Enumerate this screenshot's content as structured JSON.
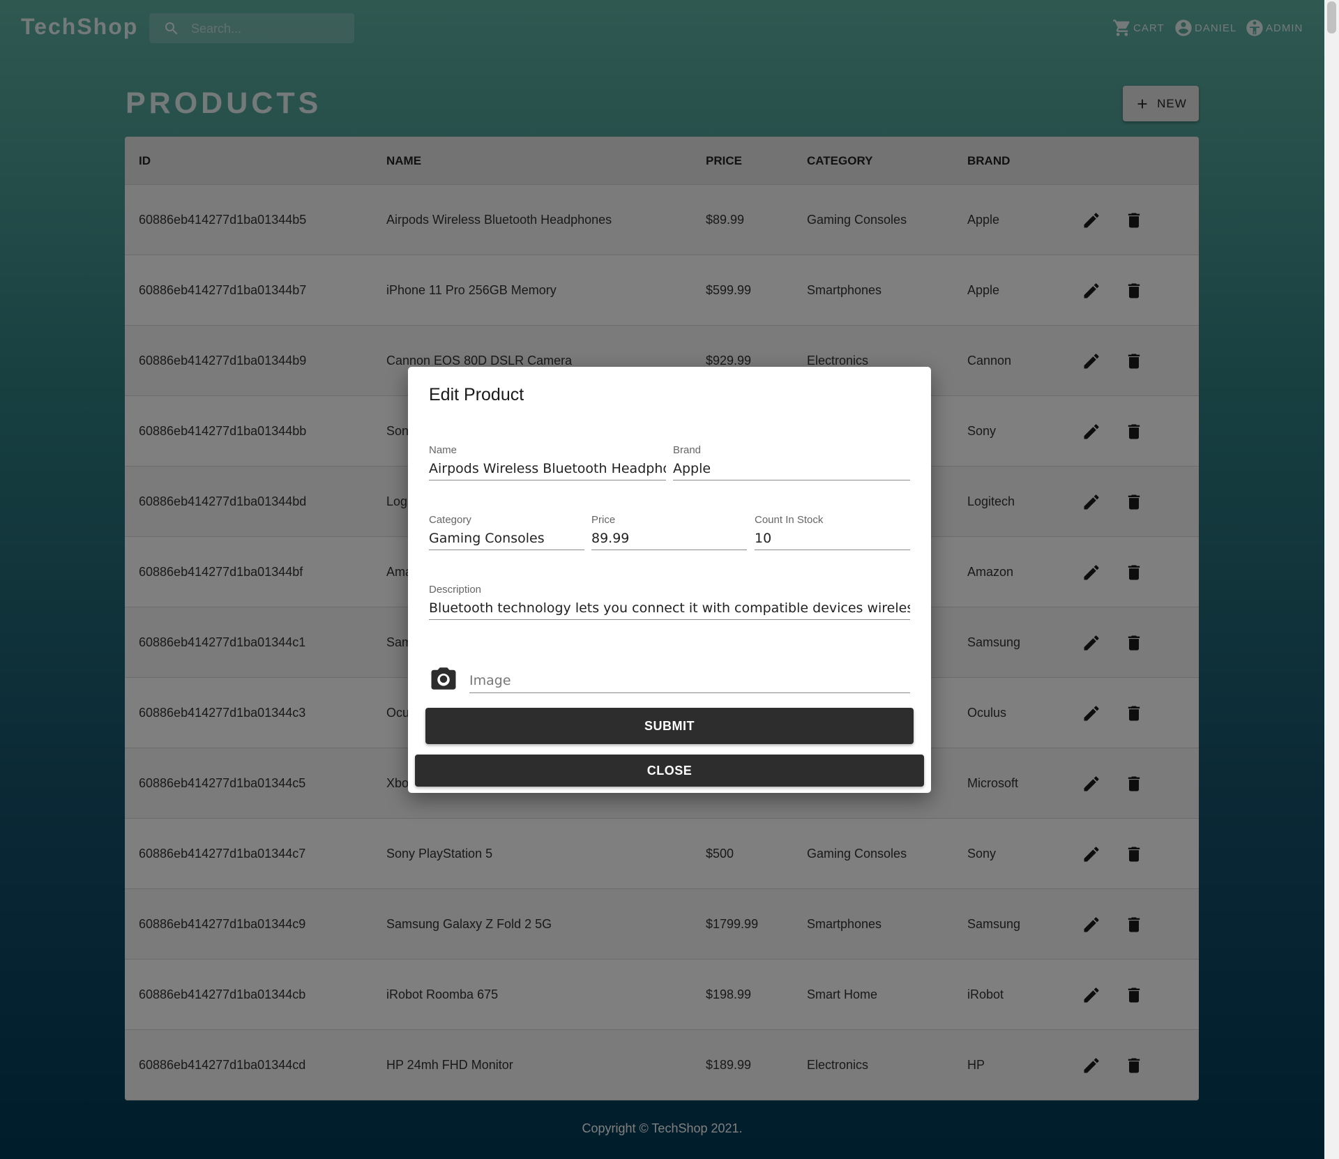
{
  "header": {
    "logo": "TechShop",
    "search_placeholder": "Search...",
    "nav": {
      "cart": "CART",
      "user": "DANIEL",
      "admin": "ADMIN"
    }
  },
  "products": {
    "title": "PRODUCTS",
    "new_label": "NEW",
    "columns": {
      "id": "ID",
      "name": "NAME",
      "price": "PRICE",
      "category": "CATEGORY",
      "brand": "BRAND"
    },
    "rows": [
      {
        "id": "60886eb414277d1ba01344b5",
        "name": "Airpods Wireless Bluetooth Headphones",
        "price": "$89.99",
        "category": "Gaming Consoles",
        "brand": "Apple"
      },
      {
        "id": "60886eb414277d1ba01344b7",
        "name": "iPhone 11 Pro 256GB Memory",
        "price": "$599.99",
        "category": "Smartphones",
        "brand": "Apple"
      },
      {
        "id": "60886eb414277d1ba01344b9",
        "name": "Cannon EOS 80D DSLR Camera",
        "price": "$929.99",
        "category": "Electronics",
        "brand": "Cannon"
      },
      {
        "id": "60886eb414277d1ba01344bb",
        "name": "Son",
        "price": "",
        "category": "",
        "brand": "Sony"
      },
      {
        "id": "60886eb414277d1ba01344bd",
        "name": "Log",
        "price": "",
        "category": "",
        "brand": "Logitech"
      },
      {
        "id": "60886eb414277d1ba01344bf",
        "name": "Ama",
        "price": "",
        "category": "",
        "brand": "Amazon"
      },
      {
        "id": "60886eb414277d1ba01344c1",
        "name": "Sam",
        "price": "",
        "category": "",
        "brand": "Samsung"
      },
      {
        "id": "60886eb414277d1ba01344c3",
        "name": "Ocu",
        "price": "",
        "category": "",
        "brand": "Oculus"
      },
      {
        "id": "60886eb414277d1ba01344c5",
        "name": "Xbo",
        "price": "",
        "category": "",
        "brand": "Microsoft"
      },
      {
        "id": "60886eb414277d1ba01344c7",
        "name": "Sony PlayStation 5",
        "price": "$500",
        "category": "Gaming Consoles",
        "brand": "Sony"
      },
      {
        "id": "60886eb414277d1ba01344c9",
        "name": "Samsung Galaxy Z Fold 2 5G",
        "price": "$1799.99",
        "category": "Smartphones",
        "brand": "Samsung"
      },
      {
        "id": "60886eb414277d1ba01344cb",
        "name": "iRobot Roomba 675",
        "price": "$198.99",
        "category": "Smart Home",
        "brand": "iRobot"
      },
      {
        "id": "60886eb414277d1ba01344cd",
        "name": "HP 24mh FHD Monitor",
        "price": "$189.99",
        "category": "Electronics",
        "brand": "HP"
      }
    ]
  },
  "footer": {
    "text": "Copyright © TechShop 2021."
  },
  "dialog": {
    "title": "Edit Product",
    "fields": {
      "name": {
        "label": "Name",
        "value": "Airpods Wireless Bluetooth Headphones"
      },
      "brand": {
        "label": "Brand",
        "value": "Apple"
      },
      "category": {
        "label": "Category",
        "value": "Gaming Consoles"
      },
      "price": {
        "label": "Price",
        "value": "89.99"
      },
      "count": {
        "label": "Count In Stock",
        "value": "10"
      },
      "description": {
        "label": "Description",
        "value": "Bluetooth technology lets you connect it with compatible devices wirelessly High-quality AAC audio offers immersive listening experience"
      },
      "image": {
        "placeholder": "Image"
      }
    },
    "submit_label": "SUBMIT",
    "close_label": "CLOSE"
  },
  "colors": {
    "overlay": "#00000080",
    "button_dark": "#2d2d2d",
    "header_text": "#e8f4f2"
  }
}
